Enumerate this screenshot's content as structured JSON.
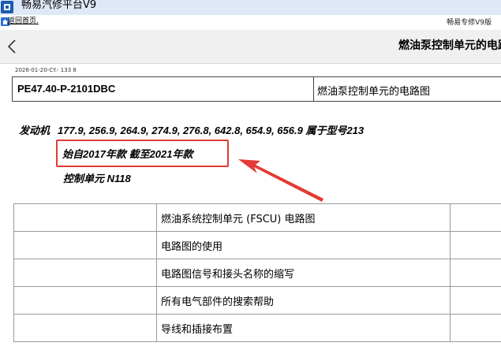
{
  "window": {
    "title": "畅易汽修平台V9"
  },
  "linkbar": {
    "back_home": "返回首页.",
    "brand": "畅易专修V9版"
  },
  "nav": {
    "title": "燃油泵控制单元的电路图"
  },
  "doc": {
    "date": "2026-01-20-CY.- 133 8",
    "code": "PE47.40-P-2101DBC",
    "name": "燃油泵控制单元的电路图"
  },
  "engine": {
    "label": "发动机",
    "models": "177.9, 256.9, 264.9, 274.9, 276.8, 642.8, 654.9, 656.9 属于型号213",
    "year_range": "始自2017年款 截至2021年款",
    "control_unit": "控制单元 N118"
  },
  "links": [
    {
      "label": "燃油系统控制单元 (FSCU) 电路图"
    },
    {
      "label": "电路图的使用"
    },
    {
      "label": "电路图信号和接头名称的缩写"
    },
    {
      "label": "所有电气部件的搜索帮助"
    },
    {
      "label": "导线和插接布置"
    }
  ],
  "colors": {
    "highlight": "#e53935",
    "titlebar": "#dfe8f6",
    "navbar": "#f0f0f0"
  },
  "icons": {
    "app": "app-logo-icon",
    "home": "home-icon",
    "back": "chevron-left-icon"
  }
}
